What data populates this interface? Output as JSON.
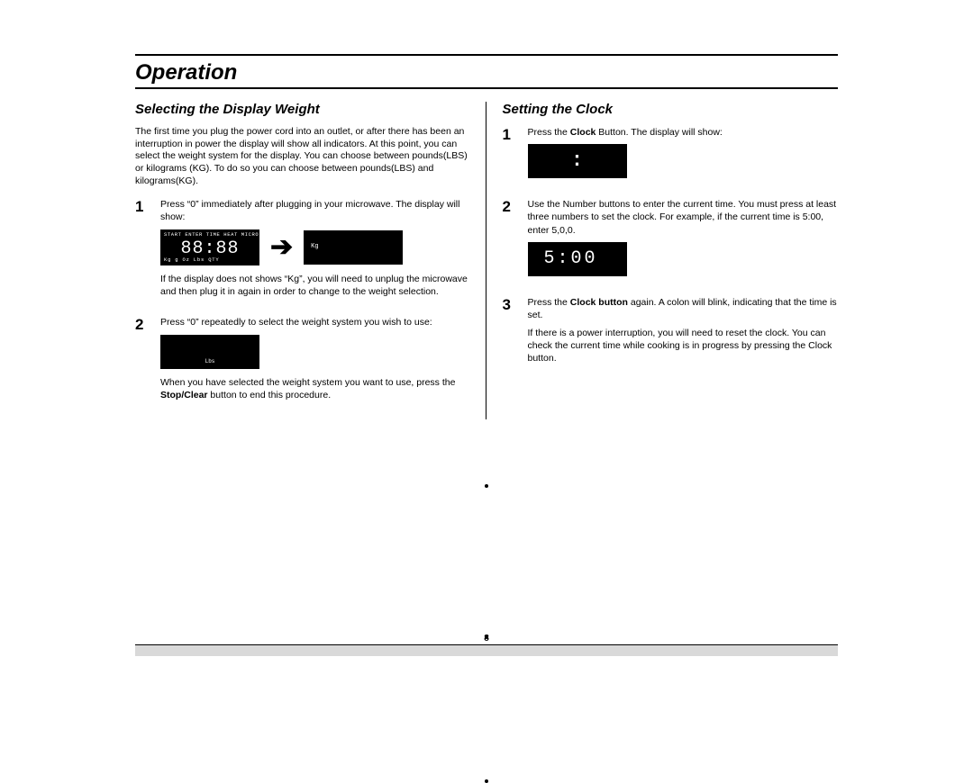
{
  "header": {
    "title": "Operation"
  },
  "left": {
    "heading": "Selecting the Display Weight",
    "intro": "The first time you plug the power cord into an outlet, or after there has been an interruption in power  the display will show all indicators. At this point, you can select the weight system for the display. You can choose between pounds(LBS) or kilograms (KG). To do so you can choose between pounds(LBS) and kilograms(KG).",
    "steps": {
      "1": {
        "num": "1",
        "text": "Press “0” immediately after plugging in your microwave. The display will show:",
        "after": "If the display does not shows “Kg”, you will need to unplug the microwave and then plug it in again in order to change to the weight selection.",
        "disp_full_top": "START  ENTER  TIME  HEAT  MICRO",
        "disp_full_digits": "88:88",
        "disp_full_bottom": "Kg    g    Oz   Lbs   QTY",
        "disp_kg": "Kg"
      },
      "2": {
        "num": "2",
        "text": "Press “0” repeatedly to select the weight system you wish to use:",
        "after_pre": "When you have selected the weight system you want to use, press the ",
        "after_bold": "Stop/Clear",
        "after_post": " button to end this procedure.",
        "disp_lbs": "Lbs"
      }
    }
  },
  "right": {
    "heading": "Setting the Clock",
    "steps": {
      "1": {
        "num": "1",
        "pre": "Press the ",
        "bold": "Clock",
        "post": " Button. The display will show:",
        "disp_colon": ":"
      },
      "2": {
        "num": "2",
        "text": "Use the Number buttons to enter the current time. You must press at least three numbers to set the clock. For example, if the current time is 5:00, enter 5,0,0.",
        "disp_500": "5:00"
      },
      "3": {
        "num": "3",
        "pre": "Press the ",
        "bold": "Clock button",
        "post": " again. A colon will blink, indicating that the time is set.",
        "after": "If there is a power interruption, you will need to reset the clock. You can check the current time while cooking is in progress by pressing the Clock  button."
      }
    }
  },
  "page_number": "8",
  "arrow_glyph": "➔"
}
